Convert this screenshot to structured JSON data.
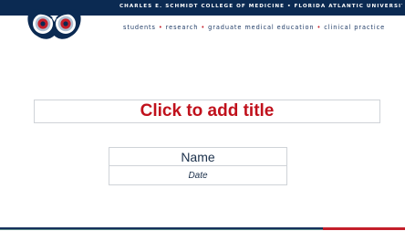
{
  "header": {
    "title": "CHARLES E. SCHMIDT COLLEGE OF MEDICINE • FLORIDA ATLANTIC UNIVERSITY",
    "subtitle_parts": [
      "students",
      "research",
      "graduate medical education",
      "clinical practice"
    ],
    "bullet": "•"
  },
  "slide": {
    "title_placeholder": "Click to add title",
    "name_label": "Name",
    "date_label": "Date"
  },
  "colors": {
    "header_band": "#0b2a52",
    "title_red": "#c0111c",
    "accent_red": "#c41f2a",
    "navy_text": "#1f3b66"
  },
  "icons": {
    "logo": "owl-logo-icon"
  }
}
